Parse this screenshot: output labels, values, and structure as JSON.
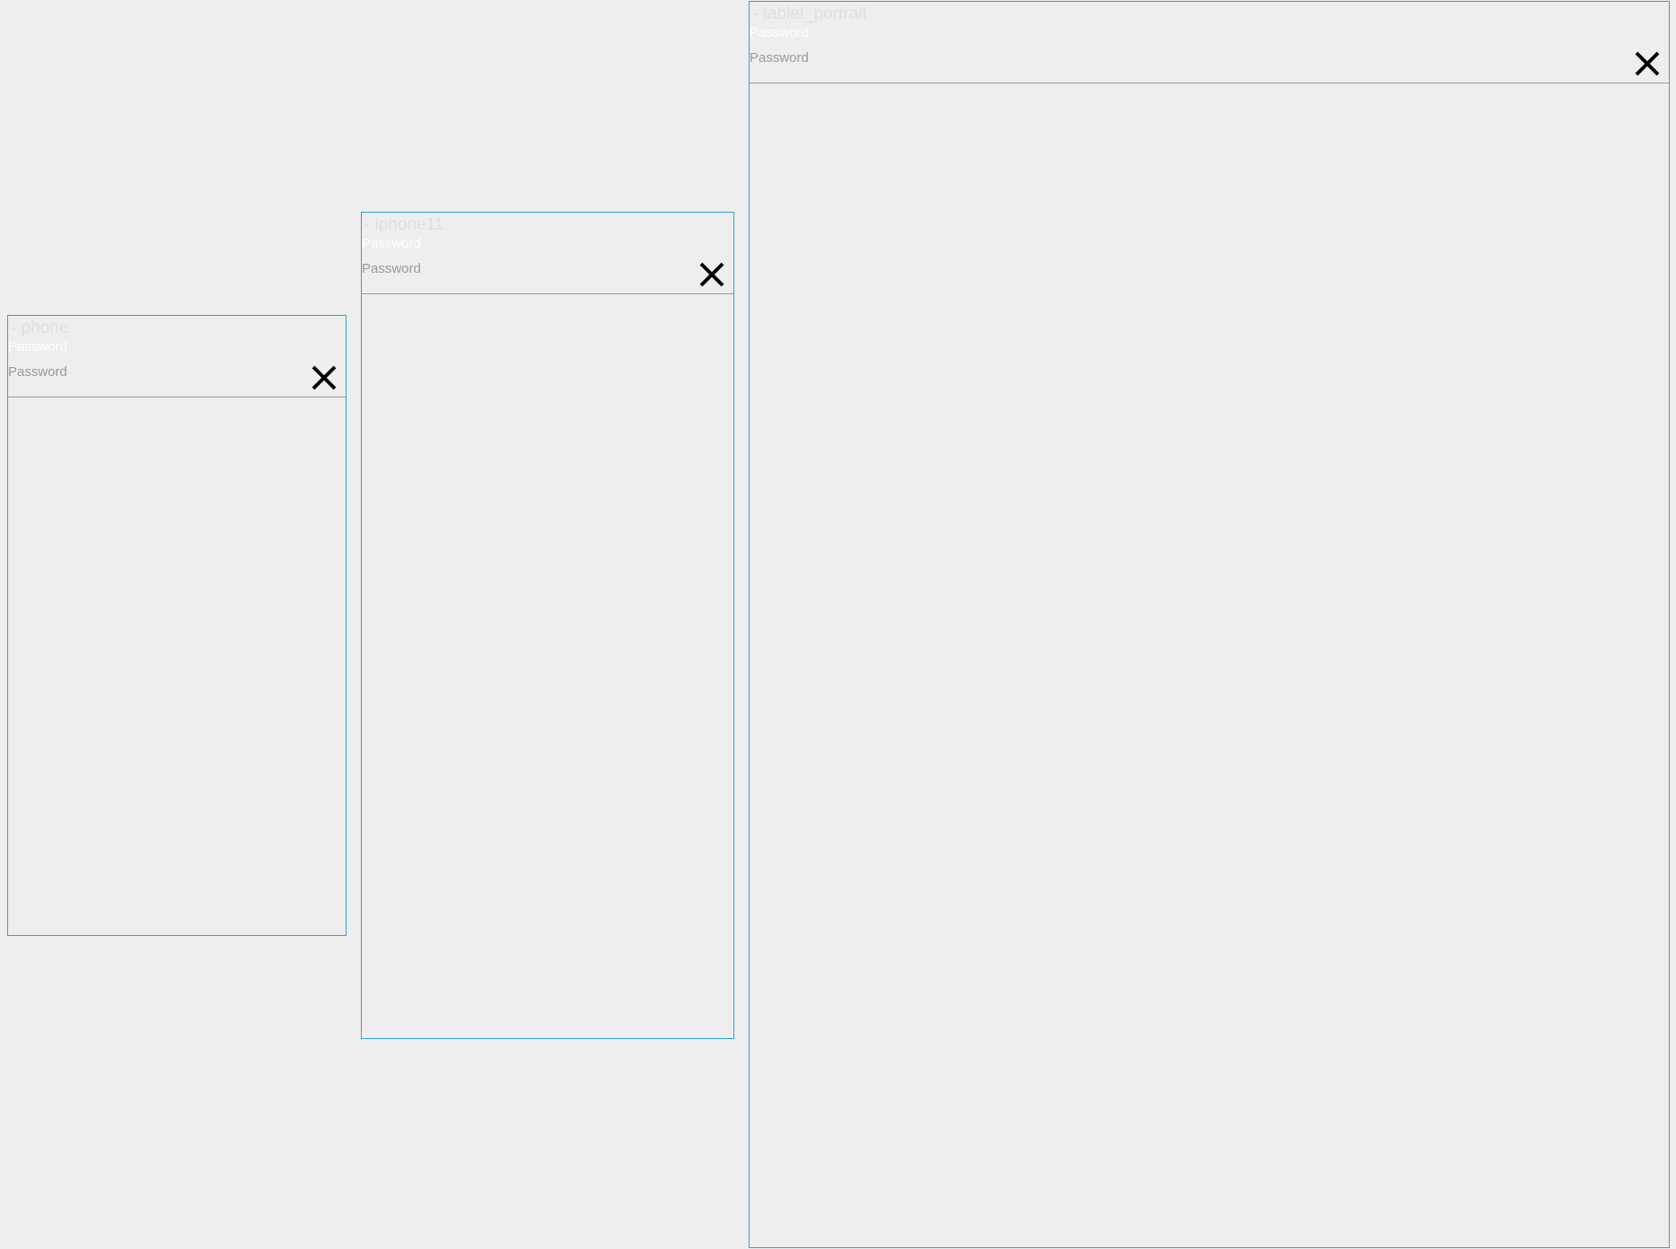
{
  "frames": {
    "phone": {
      "title": "- phone",
      "floating_label": "Password",
      "placeholder": "Password",
      "clear_icon": "close-icon"
    },
    "iphone11": {
      "title": "- iphone11",
      "floating_label": "Password",
      "placeholder": "Password",
      "clear_icon": "close-icon"
    },
    "tablet_portrait": {
      "title": "- tablet_portrait",
      "floating_label": "Password",
      "placeholder": "Password",
      "clear_icon": "close-icon"
    }
  },
  "colors": {
    "frame_border": "#29a3e0",
    "background": "#eeeeee",
    "placeholder_text": "#9a9a9a",
    "floating_label": "#ffffff",
    "frame_title": "#dcdfe3",
    "icon": "#000000"
  }
}
